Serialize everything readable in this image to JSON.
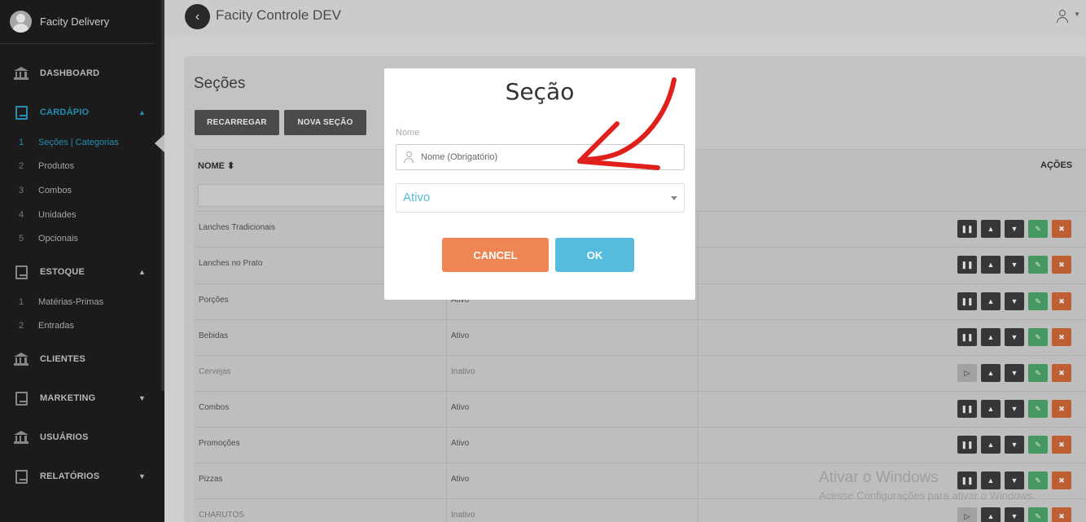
{
  "sidebar": {
    "profile_name": "Facity Delivery",
    "items": [
      {
        "label": "DASHBOARD",
        "icon": "bank-icon"
      },
      {
        "label": "CARDÁPIO",
        "icon": "book-icon",
        "caret": "▲"
      },
      {
        "label": "ESTOQUE",
        "icon": "book-icon",
        "caret": "▲"
      },
      {
        "label": "CLIENTES",
        "icon": "bank-icon"
      },
      {
        "label": "MARKETING",
        "icon": "book-icon",
        "caret": "▼"
      },
      {
        "label": "USUÁRIOS",
        "icon": "bank-icon"
      },
      {
        "label": "RELATÓRIOS",
        "icon": "book-icon",
        "caret": "▼"
      }
    ],
    "cardapio_sub": [
      {
        "num": "1",
        "label": "Seções | Categorias"
      },
      {
        "num": "2",
        "label": "Produtos"
      },
      {
        "num": "3",
        "label": "Combos"
      },
      {
        "num": "4",
        "label": "Unidades"
      },
      {
        "num": "5",
        "label": "Opcionais"
      }
    ],
    "estoque_sub": [
      {
        "num": "1",
        "label": "Matérias-Primas"
      },
      {
        "num": "2",
        "label": "Entradas"
      }
    ]
  },
  "topbar": {
    "title": "Facity Controle DEV",
    "back_icon": "chevron-left-icon",
    "user_icon": "user-icon"
  },
  "page": {
    "title": "Seções",
    "reload_label": "RECARREGAR",
    "new_label": "NOVA SEÇÃO"
  },
  "table": {
    "col_name": "NOME ⬍",
    "col_actions": "AÇÕES",
    "rows": [
      {
        "name": "Lanches Tradicionais",
        "status": "",
        "active": true
      },
      {
        "name": "Lanches no Prato",
        "status": "",
        "active": true
      },
      {
        "name": "Porções",
        "status": "Ativo",
        "active": true
      },
      {
        "name": "Bebidas",
        "status": "Ativo",
        "active": true
      },
      {
        "name": "Cervejas",
        "status": "Inativo",
        "active": false
      },
      {
        "name": "Combos",
        "status": "Ativo",
        "active": true
      },
      {
        "name": "Promoções",
        "status": "Ativo",
        "active": true
      },
      {
        "name": "Pizzas",
        "status": "Ativo",
        "active": true
      },
      {
        "name": "CHARUTOS",
        "status": "Inativo",
        "active": false
      }
    ]
  },
  "modal": {
    "title": "Seção",
    "name_label": "Nome",
    "name_placeholder": "Nome (Obrigatório)",
    "status_value": "Ativo",
    "cancel_label": "CANCEL",
    "ok_label": "OK"
  },
  "watermark": {
    "line1": "Ativar o Windows",
    "line2": "Acesse Configurações para ativar o Windows."
  },
  "colors": {
    "sidebar_bg": "#1f1f1f",
    "accent": "#2aa1c9",
    "cancel": "#ef8454",
    "ok": "#56bbdc",
    "arrow": "#e0201b"
  }
}
